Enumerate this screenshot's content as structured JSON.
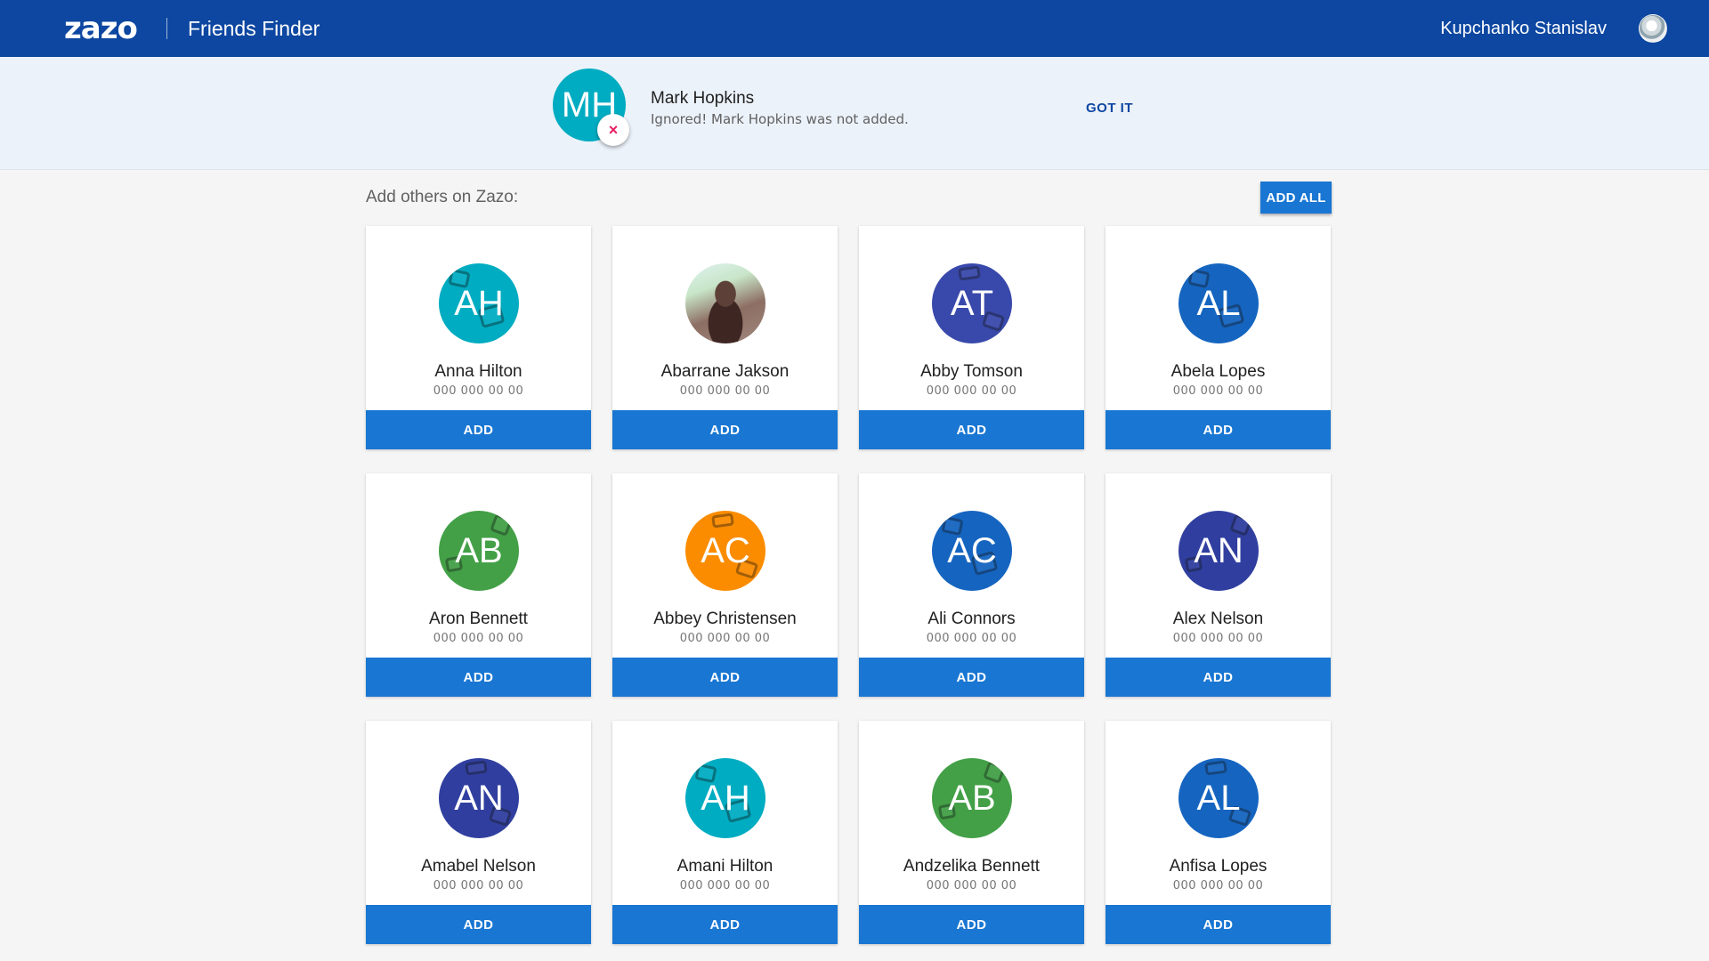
{
  "header": {
    "logo": "zazo",
    "app_title": "Friends Finder",
    "user_name": "Kupchanko Stanislav",
    "user_avatar_icon": "user-avatar"
  },
  "notice": {
    "initials": "MH",
    "name": "Mark Hopkins",
    "message": "Ignored!  Mark Hopkins was not added.",
    "action": "GOT IT",
    "remove_icon": "×",
    "avatar_color": "#00acc1"
  },
  "section": {
    "title": "Add others on Zazo:",
    "add_all": "ADD ALL"
  },
  "contacts": [
    {
      "initials": "AH",
      "name": "Anna Hilton",
      "phone": "000 000 00 00",
      "color": "#00acc1",
      "button": "ADD"
    },
    {
      "initials": "",
      "name": "Abarrane Jakson",
      "phone": "000 000 00 00",
      "color": "#8d6e63",
      "button": "ADD",
      "photo": true
    },
    {
      "initials": "AT",
      "name": "Abby Tomson",
      "phone": "000 000 00 00",
      "color": "#3949ab",
      "button": "ADD"
    },
    {
      "initials": "AL",
      "name": "Abela Lopes",
      "phone": "000 000 00 00",
      "color": "#1565c0",
      "button": "ADD"
    },
    {
      "initials": "AB",
      "name": "Aron Bennett",
      "phone": "000 000 00 00",
      "color": "#43a047",
      "button": "ADD"
    },
    {
      "initials": "AC",
      "name": "Abbey Christensen",
      "phone": "000 000 00 00",
      "color": "#fb8c00",
      "button": "ADD"
    },
    {
      "initials": "AC",
      "name": "Ali Connors",
      "phone": "000 000 00 00",
      "color": "#1565c0",
      "button": "ADD"
    },
    {
      "initials": "AN",
      "name": "Alex Nelson",
      "phone": "000 000 00 00",
      "color": "#303f9f",
      "button": "ADD"
    },
    {
      "initials": "AN",
      "name": "Amabel Nelson",
      "phone": "000 000 00 00",
      "color": "#303f9f",
      "button": "ADD"
    },
    {
      "initials": "AH",
      "name": "Amani Hilton",
      "phone": "000 000 00 00",
      "color": "#00acc1",
      "button": "ADD"
    },
    {
      "initials": "AB",
      "name": "Andzelika Bennett",
      "phone": "000 000 00 00",
      "color": "#43a047",
      "button": "ADD"
    },
    {
      "initials": "AL",
      "name": "Anfisa Lopes",
      "phone": "000 000 00 00",
      "color": "#1565c0",
      "button": "ADD"
    }
  ],
  "colors": {
    "header_bg": "#0d47a1",
    "notice_bg": "#ecf2fa",
    "button_bg": "#1976d2",
    "page_bg": "#f5f5f5"
  }
}
